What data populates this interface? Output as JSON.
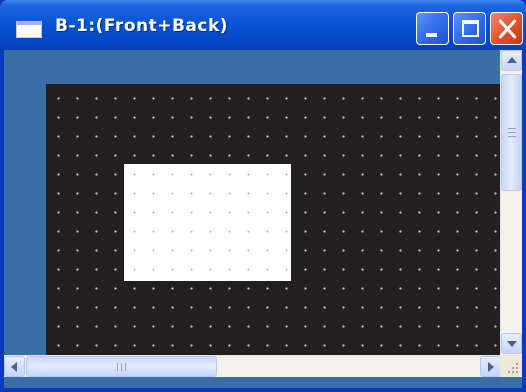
{
  "window": {
    "title": "B-1:(Front+Back)",
    "icon": "window-icon"
  },
  "titlebar_buttons": {
    "minimize": "minimize-icon",
    "maximize": "maximize-icon",
    "close": "close-icon"
  },
  "canvas": {
    "background_color": "#231f20",
    "grid_dot_color": "#cfcfcf",
    "rect_color": "#ffffff"
  },
  "scrollbars": {
    "up": "arrow-up-icon",
    "down": "arrow-down-icon",
    "left": "arrow-left-icon",
    "right": "arrow-right-icon"
  },
  "colors": {
    "titlebar": "#0755d8",
    "workspace": "#3a6ea5",
    "close_button": "#e0512c"
  }
}
